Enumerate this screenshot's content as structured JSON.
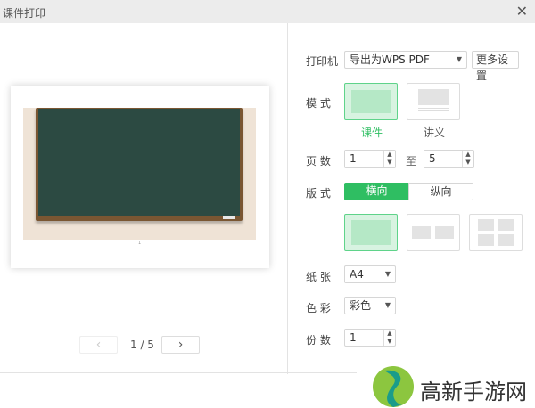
{
  "dialog": {
    "title": "课件打印",
    "close": "✕"
  },
  "preview": {
    "page_label": "1",
    "indicator": "1 / 5",
    "prev": "‹",
    "next": "›"
  },
  "settings": {
    "printer": {
      "label": "打印机",
      "value": "导出为WPS PDF",
      "more": "更多设置"
    },
    "mode": {
      "label": "模 式",
      "options": [
        "课件",
        "讲义"
      ],
      "selected": "课件"
    },
    "pages": {
      "label": "页 数",
      "from": "1",
      "to_label": "至",
      "to": "5"
    },
    "orientation": {
      "label": "版 式",
      "options": [
        "横向",
        "纵向"
      ],
      "selected": "横向"
    },
    "paper": {
      "label": "纸 张",
      "value": "A4"
    },
    "color": {
      "label": "色 彩",
      "value": "彩色"
    },
    "copies": {
      "label": "份 数",
      "value": "1"
    }
  },
  "watermark": {
    "text": "高新手游网"
  },
  "colors": {
    "accent": "#2fbe62"
  }
}
